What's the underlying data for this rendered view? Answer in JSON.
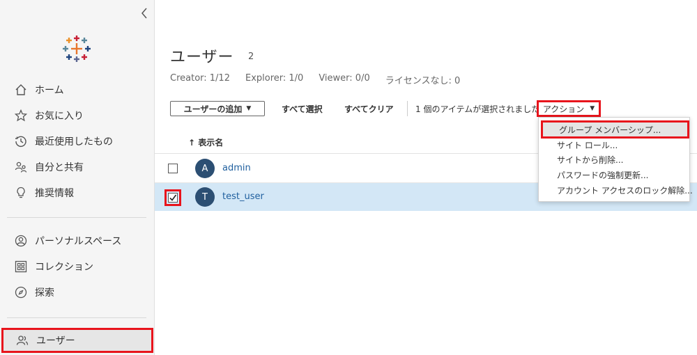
{
  "sidebar": {
    "collapse_icon": "chevron-left-icon",
    "brand_colors": [
      "#e8762d",
      "#59879b",
      "#c72035",
      "#5b6591",
      "#1f447e",
      "#eb9129"
    ],
    "items": [
      {
        "label": "ホーム",
        "icon": "home-icon"
      },
      {
        "label": "お気に入り",
        "icon": "star-icon"
      },
      {
        "label": "最近使用したもの",
        "icon": "history-icon"
      },
      {
        "label": "自分と共有",
        "icon": "shared-icon"
      },
      {
        "label": "推奨情報",
        "icon": "lightbulb-icon"
      },
      {
        "label": "パーソナルスペース",
        "icon": "person-icon"
      },
      {
        "label": "コレクション",
        "icon": "collection-icon"
      },
      {
        "label": "探索",
        "icon": "compass-icon"
      },
      {
        "label": "ユーザー",
        "icon": "users-icon"
      }
    ]
  },
  "page": {
    "title": "ユーザー",
    "count": "2",
    "stats": [
      "Creator: 1/12",
      "Explorer: 1/0",
      "Viewer: 0/0",
      "ライセンスなし: 0"
    ]
  },
  "toolbar": {
    "add_user": "ユーザーの追加",
    "select_all": "すべて選択",
    "clear_all": "すべてクリア",
    "selection_status": "1 個のアイテムが選択されました",
    "actions": "アクション"
  },
  "table": {
    "column_header": "↑ 表示名",
    "rows": [
      {
        "initial": "A",
        "name": "admin",
        "checked": false
      },
      {
        "initial": "T",
        "name": "test_user",
        "checked": true
      }
    ]
  },
  "actions_menu": {
    "items": [
      "グループ メンバーシップ...",
      "サイト ロール...",
      "サイトから削除...",
      "パスワードの強制更新...",
      "アカウント アクセスのロック解除..."
    ]
  },
  "colors": {
    "highlight": "#e8141c",
    "selected_row": "#d3e7f6",
    "avatar": "#2c4f73",
    "link": "#1f5f9e"
  }
}
